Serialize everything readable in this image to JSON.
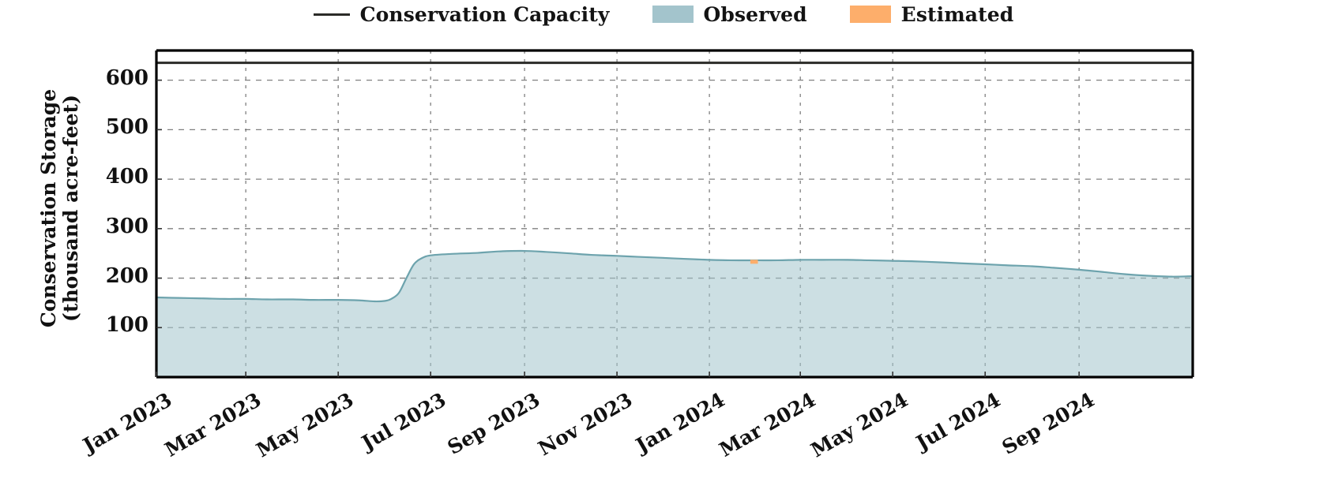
{
  "legend": {
    "position": "above-plot-center",
    "entries": [
      {
        "label": "Conservation Capacity",
        "marker": "line",
        "color": "#2b2b28"
      },
      {
        "label": "Observed",
        "marker": "patch",
        "color": "#a3c4cc"
      },
      {
        "label": "Estimated",
        "marker": "patch",
        "color": "#fdae6b"
      }
    ]
  },
  "axes": {
    "ylabel": "Conservation Storage\n(thousand acre-feet)",
    "xlabel": "",
    "yticks": [
      "100",
      "200",
      "300",
      "400",
      "500",
      "600"
    ],
    "xticks": [
      "Jan 2023",
      "Mar 2023",
      "May 2023",
      "Jul 2023",
      "Sep 2023",
      "Nov 2023",
      "Jan 2024",
      "Mar 2024",
      "May 2024",
      "Jul 2024",
      "Sep 2024"
    ]
  },
  "chart_data": {
    "type": "area",
    "title": "",
    "xlabel": "",
    "ylabel": "Conservation Storage (thousand acre-feet)",
    "xlim": [
      "2023-01-01",
      "2024-11-15"
    ],
    "ylim": [
      0,
      660
    ],
    "grid": true,
    "yticks": [
      100,
      200,
      300,
      400,
      500,
      600
    ],
    "xticks": [
      "Jan 2023",
      "Mar 2023",
      "May 2023",
      "Jul 2023",
      "Sep 2023",
      "Nov 2023",
      "Jan 2024",
      "Mar 2024",
      "May 2024",
      "Jul 2024",
      "Sep 2024"
    ],
    "reference_lines": [
      {
        "name": "Conservation Capacity",
        "value": 635,
        "color": "#2b2b28"
      }
    ],
    "series": [
      {
        "name": "Observed",
        "type": "area",
        "color": "#a3c4cc",
        "line_color": "#6da3ad",
        "x": [
          "2023-01-01",
          "2023-01-15",
          "2023-02-01",
          "2023-02-15",
          "2023-03-01",
          "2023-03-15",
          "2023-04-01",
          "2023-04-15",
          "2023-05-01",
          "2023-05-15",
          "2023-05-25",
          "2023-06-01",
          "2023-06-05",
          "2023-06-10",
          "2023-06-15",
          "2023-06-20",
          "2023-06-25",
          "2023-07-01",
          "2023-07-15",
          "2023-08-01",
          "2023-08-15",
          "2023-09-01",
          "2023-09-15",
          "2023-10-01",
          "2023-10-15",
          "2023-11-01",
          "2023-11-15",
          "2023-12-01",
          "2023-12-15",
          "2024-01-01",
          "2024-01-15",
          "2024-02-01",
          "2024-02-15",
          "2024-03-01",
          "2024-03-15",
          "2024-04-01",
          "2024-04-15",
          "2024-05-01",
          "2024-05-15",
          "2024-06-01",
          "2024-06-15",
          "2024-07-01",
          "2024-07-15",
          "2024-08-01",
          "2024-08-15",
          "2024-09-01",
          "2024-09-15",
          "2024-10-01",
          "2024-10-15",
          "2024-11-01",
          "2024-11-15"
        ],
        "values": [
          161,
          160,
          159,
          158,
          158,
          157,
          157,
          156,
          156,
          155,
          153,
          154,
          158,
          170,
          200,
          228,
          240,
          246,
          249,
          251,
          254,
          255,
          253,
          250,
          247,
          245,
          243,
          241,
          239,
          237,
          236,
          236,
          236,
          237,
          237,
          237,
          236,
          235,
          234,
          232,
          230,
          228,
          226,
          224,
          221,
          217,
          213,
          208,
          205,
          203,
          204
        ]
      },
      {
        "name": "Estimated",
        "type": "area",
        "color": "#fdae6b",
        "x": [
          "2024-01-28",
          "2024-02-02"
        ],
        "values": [
          237,
          237
        ]
      }
    ]
  }
}
